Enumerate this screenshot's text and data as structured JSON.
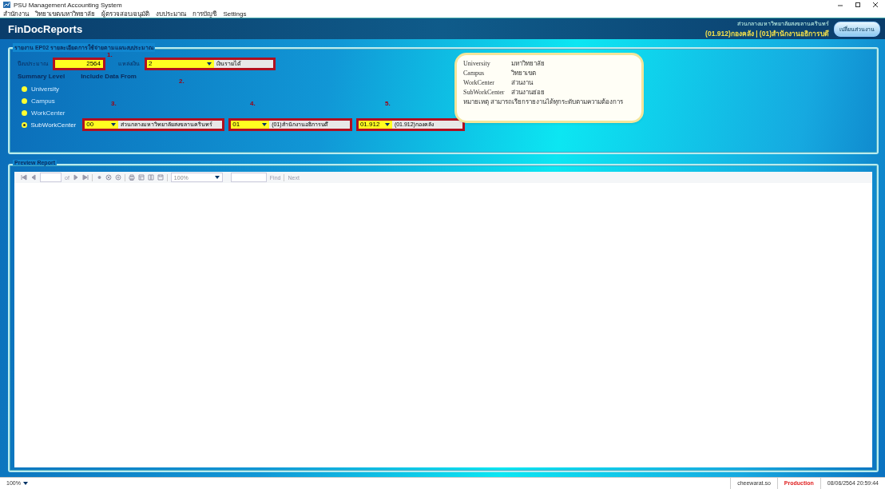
{
  "window": {
    "title": "PSU Management Accounting System"
  },
  "menu": [
    "สำนักงาน",
    "วิทยาเขต/มหาวิทยาลัย",
    "ผู้ตรวจสอบ/อนุมัติ",
    "งบประมาณ",
    "การบัญชี",
    "Settings"
  ],
  "header": {
    "title": "FinDocReports",
    "org": "ส่วนกลางมหาวิทยาลัยสงขลานครินทร์",
    "unit": "(01.912)กองคลัง | (01)สำนักงานอธิการบดี",
    "button": "เปลี่ยนส่วนงาน"
  },
  "filter_panel": {
    "title": "รายงาน EP02 รายละเอียดการใช้จ่ายตามแผนงบประมาณ",
    "year": {
      "label": "ปีงบประมาณ",
      "value": "2564"
    },
    "fund": {
      "label": "แหล่งเงิน",
      "code": "2",
      "name": "เงินรายได้"
    },
    "summary_label": "Summary Level",
    "include_label": "Include Data From",
    "levels": [
      {
        "label": "University",
        "selected": false
      },
      {
        "label": "Campus",
        "selected": false
      },
      {
        "label": "WorkCenter",
        "selected": false
      },
      {
        "label": "SubWorkCenter",
        "selected": true
      }
    ],
    "include": [
      {
        "code": "00",
        "name": "ส่วนกลางมหาวิทยาลัยสงขลานครินทร์"
      },
      {
        "code": "01",
        "name": "(01)สำนักงานอธิการบดี"
      },
      {
        "code": "01.912",
        "name": "(01.912)กองคลัง"
      }
    ],
    "step_marks": [
      "1.",
      "2.",
      "3.",
      "4.",
      "5."
    ],
    "legend": [
      {
        "term": "University",
        "meaning": "มหาวิทยาลัย"
      },
      {
        "term": "Campus",
        "meaning": "วิทยาเขต"
      },
      {
        "term": "WorkCenter",
        "meaning": "ส่วนงาน"
      },
      {
        "term": "SubWorkCenter",
        "meaning": "ส่วนงานย่อย"
      }
    ],
    "legend_note": "หมายเหตุ สามารถเรียกรายงานได้ทุกระดับตามความต้องการ"
  },
  "preview": {
    "title": "Preview Report",
    "of": "of",
    "zoom": "100%",
    "find": "Find",
    "next": "Next"
  },
  "status_bar": {
    "zoom": "100%",
    "user": "cheewarat.so",
    "environment": "Production",
    "datetime": "08/06/2564 20:59:44"
  }
}
